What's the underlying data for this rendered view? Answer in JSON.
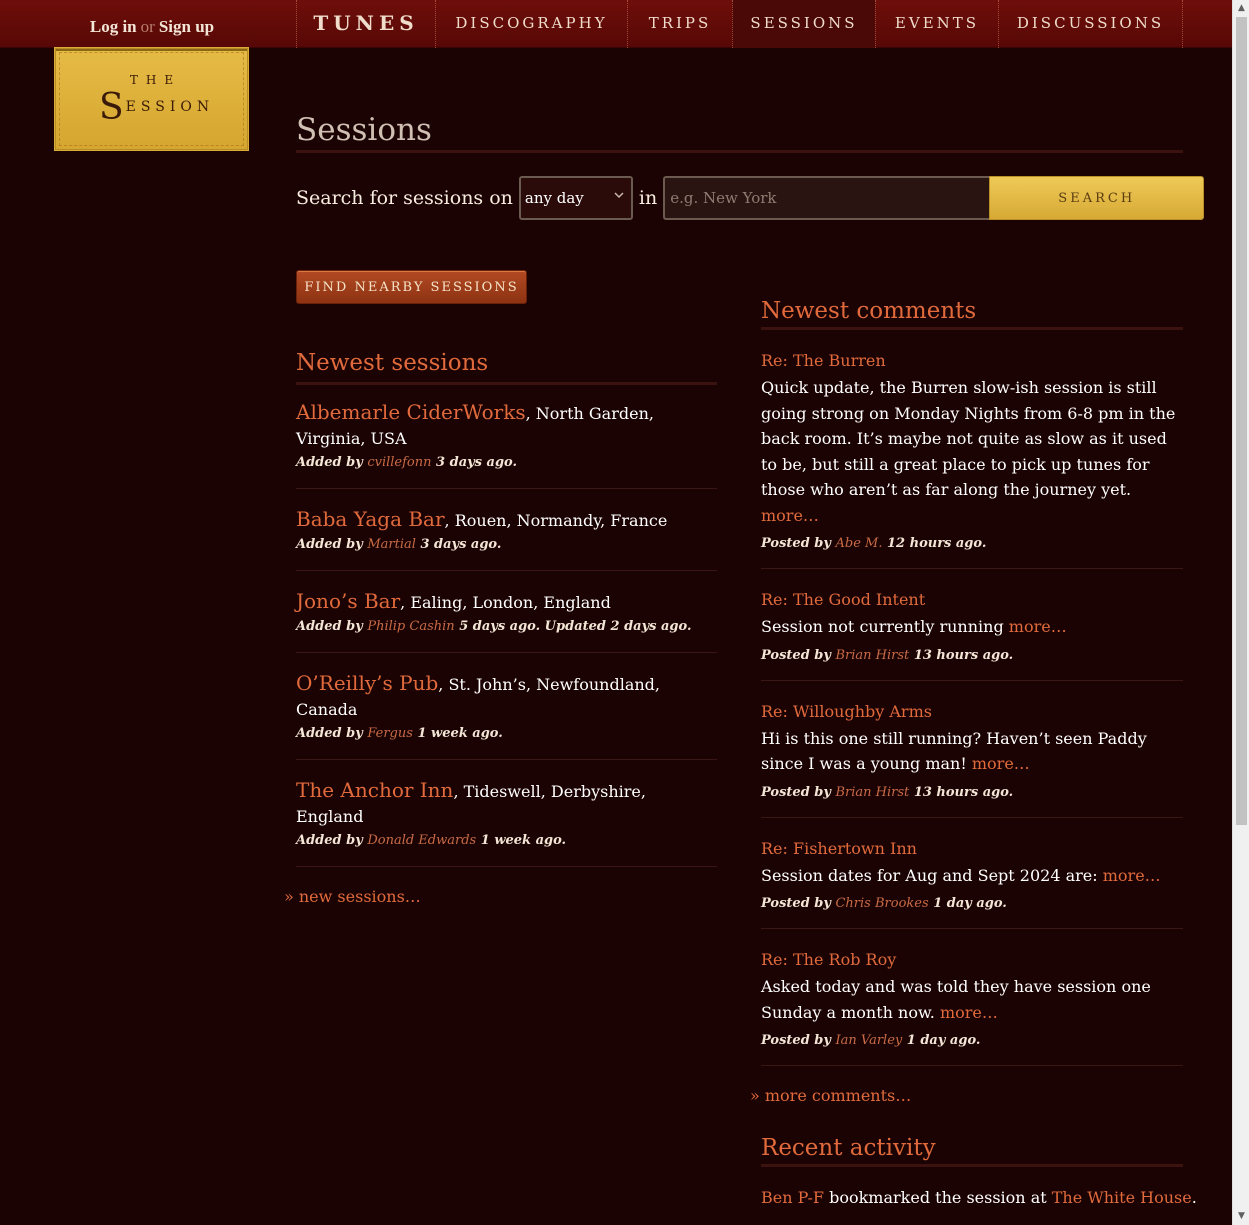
{
  "header": {
    "login": "Log in",
    "or": "or",
    "signup": "Sign up",
    "nav": [
      "TUNES",
      "DISCOGRAPHY",
      "TRIPS",
      "SESSIONS",
      "EVENTS",
      "DISCUSSIONS"
    ],
    "active_nav": "SESSIONS"
  },
  "logo": {
    "the": "THE",
    "cap": "S",
    "rest": "ESSION"
  },
  "page": {
    "title": "Sessions"
  },
  "search": {
    "label": "Search for sessions on",
    "day_value": "any day",
    "in_label": "in",
    "placeholder": "e.g. New York",
    "button": "SEARCH"
  },
  "nearby_button": "FIND NEARBY SESSIONS",
  "newest_sessions": {
    "heading": "Newest sessions",
    "items": [
      {
        "name": "Albemarle CiderWorks",
        "place": ", North Garden, Virginia, USA",
        "added_by_label": "Added by",
        "user": "cvillefonn",
        "when": "3 days ago."
      },
      {
        "name": "Baba Yaga Bar",
        "place": ", Rouen, Normandy, France",
        "added_by_label": "Added by",
        "user": "Martial",
        "when": "3 days ago."
      },
      {
        "name": "Jono’s Bar",
        "place": ", Ealing, London, England",
        "added_by_label": "Added by",
        "user": "Philip Cashin",
        "when": "5 days ago. Updated 2 days ago."
      },
      {
        "name": "O’Reilly’s Pub",
        "place": ", St. John’s, Newfoundland, Canada",
        "added_by_label": "Added by",
        "user": "Fergus",
        "when": "1 week ago."
      },
      {
        "name": "The Anchor Inn",
        "place": ", Tideswell, Derbyshire, England",
        "added_by_label": "Added by",
        "user": "Donald Edwards",
        "when": "1 week ago."
      }
    ],
    "more_link": "» new sessions…"
  },
  "newest_comments": {
    "heading": "Newest comments",
    "items": [
      {
        "re": "Re: The Burren",
        "body": "Quick update, the Burren slow-ish session is still going strong on Monday Nights from 6-8 pm in the back room. It’s maybe not quite as slow as it used to be, but still a great place to pick up tunes for those who aren’t as far along the journey yet.",
        "more": "more…",
        "posted_by_label": "Posted by",
        "user": "Abe M.",
        "when": "12 hours ago."
      },
      {
        "re": "Re: The Good Intent",
        "body": "Session not currently running",
        "more": "more…",
        "posted_by_label": "Posted by",
        "user": "Brian Hirst",
        "when": "13 hours ago."
      },
      {
        "re": "Re: Willoughby Arms",
        "body": "Hi is this one still running? Haven’t seen Paddy since I was a young man!",
        "more": "more…",
        "posted_by_label": "Posted by",
        "user": "Brian Hirst",
        "when": "13 hours ago."
      },
      {
        "re": "Re: Fishertown Inn",
        "body": "Session dates for Aug and Sept 2024 are:",
        "more": "more…",
        "posted_by_label": "Posted by",
        "user": "Chris Brookes",
        "when": "1 day ago."
      },
      {
        "re": "Re: The Rob Roy",
        "body": "Asked today and was told they have session one Sunday a month now.",
        "more": "more…",
        "posted_by_label": "Posted by",
        "user": "Ian Varley",
        "when": "1 day ago."
      }
    ],
    "more_link": "» more comments…"
  },
  "recent_activity": {
    "heading": "Recent activity",
    "user": "Ben P-F",
    "action": " bookmarked the session at ",
    "target": "The White House",
    "end": "."
  },
  "colors": {
    "background": "#1c0303",
    "accent": "#e06a3c",
    "gold": "#dcae3a",
    "header": "#6e0e0a"
  }
}
